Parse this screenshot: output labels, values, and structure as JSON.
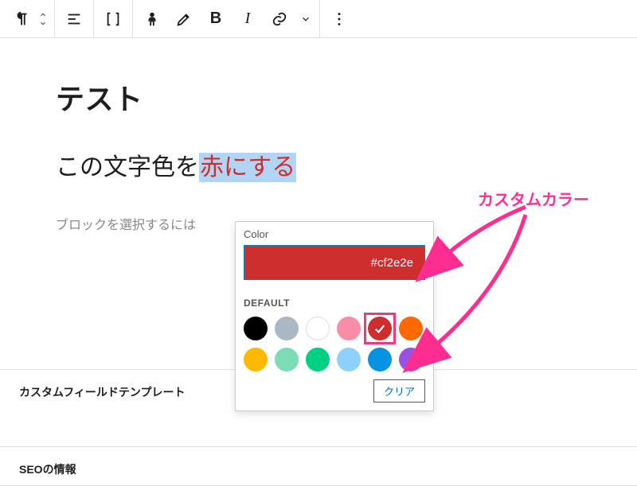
{
  "toolbar": {
    "block_type_aria": "Paragraph",
    "align_aria": "Align",
    "columns_aria": "Content width",
    "rubi_aria": "Rubi",
    "highlight_aria": "Highlight",
    "bold_label": "B",
    "italic_label": "I",
    "link_aria": "Link",
    "dropdown_aria": "More rich text controls",
    "more_aria": "Options"
  },
  "post": {
    "title": "テスト",
    "paragraph_before": "この文字色を",
    "paragraph_selected": "赤にする",
    "helper_text": "ブロックを選択するには"
  },
  "color_popover": {
    "label": "Color",
    "hex": "#cf2e2e",
    "section_label": "DEFAULT",
    "swatches": [
      {
        "name": "black",
        "hex": "#000000"
      },
      {
        "name": "gray",
        "hex": "#abb8c3"
      },
      {
        "name": "white",
        "hex": "#ffffff"
      },
      {
        "name": "pink",
        "hex": "#f78da7"
      },
      {
        "name": "red",
        "hex": "#cf2e2e",
        "selected": true
      },
      {
        "name": "orange",
        "hex": "#ff6900"
      },
      {
        "name": "amber",
        "hex": "#fcb900"
      },
      {
        "name": "lightgreen",
        "hex": "#7bdcb5"
      },
      {
        "name": "green",
        "hex": "#00d084"
      },
      {
        "name": "skyblue",
        "hex": "#8ed1fc"
      },
      {
        "name": "blue",
        "hex": "#0693e3"
      },
      {
        "name": "purple",
        "hex": "#9b51e0"
      }
    ],
    "clear_label": "クリア"
  },
  "metaboxes": {
    "cft": "カスタムフィールドテンプレート",
    "seo": "SEOの情報"
  },
  "annotation": {
    "label": "カスタムカラー"
  }
}
